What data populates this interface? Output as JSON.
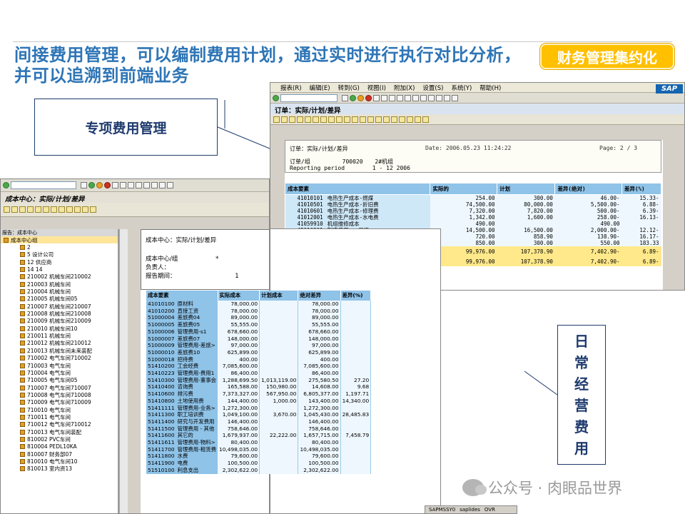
{
  "slide": {
    "title": "间接费用管理，可以编制费用计划，通过实时进行执行对比分析，并可以追溯到前端业务",
    "badge": "财务管理集约化",
    "callout_left": "专项费用管理",
    "callout_right": "日常经营费用",
    "watermark": "公众号 · 肉眼品世界",
    "colors": {
      "title": "#2e75b6",
      "badge": "#ffc000",
      "box_border": "#1f3b6e",
      "table_header": "#8fc3e8"
    }
  },
  "sap_right": {
    "menu": [
      "报表(R)",
      "编辑(E)",
      "转到(G)",
      "视图(I)",
      "附加(X)",
      "设置(S)",
      "系统(Y)",
      "帮助(H)"
    ],
    "logo": "SAP",
    "screen_title": "订单：实际/计划/差异",
    "report": {
      "name": "订单：实际/计划/差异",
      "date_label": "Date:",
      "date": "2006.05.23",
      "time": "11:24:22",
      "page_label": "Page:",
      "page": "2",
      "pages": "3",
      "order_label": "订单/组",
      "order_no": "700020",
      "order_name": "2#机组",
      "period_label": "Reporting period",
      "period_from": "1",
      "period_to": "12 2006",
      "columns": [
        "成本要素",
        "实际的",
        "计划",
        "差异(绝对)",
        "差异(%)"
      ],
      "rows": [
        [
          "41010101",
          "电热生产成本-燃煤",
          "254.00",
          "300.00",
          "46.00-",
          "15.33-"
        ],
        [
          "41010501",
          "电热生产成本-折旧费",
          "74,500.00",
          "80,000.00",
          "5,500.00-",
          "6.88-"
        ],
        [
          "41010601",
          "电热生产成本-修理费",
          "7,320.00",
          "7,820.00",
          "500.00-",
          "6.39-"
        ],
        [
          "41012001",
          "电热生产成本-水电费",
          "1,342.00",
          "1,600.00",
          "258.00-",
          "16.13-"
        ],
        [
          "41059910",
          "机组维修成本",
          "490.00",
          "",
          "490.00",
          ""
        ],
        [
          "42010201",
          "制造费用 - 工资",
          "14,500.00",
          "16,500.00",
          "2,000.00-",
          "12.12-"
        ],
        [
          "94300010",
          "检修活动成本",
          "720.00",
          "858.90",
          "138.90-",
          "16.17-"
        ],
        [
          "94300011",
          "运行工时成本",
          "850.00",
          "300.00",
          "550.00",
          "183.33"
        ]
      ],
      "total_label": "成本",
      "total_marker": "*",
      "total": [
        "99,976.00",
        "107,378.90",
        "7,402.90-",
        "6.89-"
      ],
      "balance_label": "余额",
      "balance_marker": "**",
      "balance": [
        "99,976.00",
        "107,378.90",
        "7,402.90-",
        "6.89-"
      ]
    }
  },
  "sap_left": {
    "screen_title": "成本中心：实际/计划/差异",
    "tree_header": "报告：成本中心",
    "tree_root": "成本中心组",
    "tree_items": [
      "2",
      "5 设计公司",
      "12 供应商",
      "14 14",
      "210002 机械车间210002",
      "210003 机械车间",
      "210004 机械车间",
      "210005 机械车间05",
      "210007 机械车间210007",
      "210008 机械车间210008",
      "210009 机械车间210009",
      "210010 机械车间10",
      "210011 机械车间",
      "210012 机械车间210012",
      "210013 机械车间未来装配",
      "710002 电气车间710002",
      "710003 电气车间",
      "710004 电气车间",
      "710005 电气车间05",
      "710007 电气车间710007",
      "710008 电气车间710008",
      "710009 电气车间710009",
      "710010 电气车间",
      "710011 电气车间",
      "710012 电气车间710012",
      "710013 电气车间装配",
      "810002 PVC车间",
      "810004 PEDL10KA",
      "810007 财务部07",
      "810010 电气车间10",
      "810013 室内资13"
    ],
    "report": {
      "title": "成本中心：实际/计划/差异",
      "cc_label": "成本中心/组",
      "cc_value": "*",
      "owner_label": "负责人：",
      "period_label": "报告期间：",
      "period_value": "1",
      "columns": [
        "成本要素",
        "实际成本",
        "计划成本",
        "绝对差异",
        "差异(%)"
      ],
      "rows": [
        [
          "41010100",
          "原材料",
          "78,000.00",
          "",
          "78,000.00",
          ""
        ],
        [
          "41010200",
          "直接工资",
          "78,000.00",
          "",
          "78,000.00",
          ""
        ],
        [
          "51000004",
          "差旅费04",
          "89,000.00",
          "",
          "89,000.00",
          ""
        ],
        [
          "51000005",
          "差旅费05",
          "55,555.00",
          "",
          "55,555.00",
          ""
        ],
        [
          "51000006",
          "管理费用-s1",
          "678,660.00",
          "",
          "678,660.00",
          ""
        ],
        [
          "51000007",
          "差旅费07",
          "148,000.00",
          "",
          "148,000.00",
          ""
        ],
        [
          "51000009",
          "管理费用-差旅>",
          "97,000.00",
          "",
          "97,000.00",
          ""
        ],
        [
          "51000010",
          "差旅费10",
          "625,899.00",
          "",
          "625,899.00",
          ""
        ],
        [
          "51000018",
          "招待费",
          "400.00",
          "",
          "400.00",
          ""
        ],
        [
          "51410200",
          "工会经费",
          "7,085,600.00",
          "",
          "7,085,600.00",
          ""
        ],
        [
          "51410223",
          "管理费用-费用1",
          "86,400.00",
          "",
          "86,400.00",
          ""
        ],
        [
          "51410300",
          "管理费用-董事会",
          "1,288,699.50",
          "1,013,119.00",
          "275,580.50",
          "27.20"
        ],
        [
          "51410400",
          "咨询费",
          "165,588.00",
          "150,980.00",
          "14,608.00",
          "9.68"
        ],
        [
          "51410600",
          "排污费",
          "7,373,327.00",
          "567,950.00",
          "6,805,377.00",
          "1,197.71"
        ],
        [
          "51410800",
          "土地使用费",
          "144,400.00",
          "1,000.00",
          "143,400.00",
          "14,340.00"
        ],
        [
          "51411111",
          "管理费用-业务>",
          "1,272,300.00",
          "",
          "1,272,300.00",
          ""
        ],
        [
          "51411300",
          "职工培训费",
          "1,049,100.00",
          "3,670.00",
          "1,045,430.00",
          "28,485.83"
        ],
        [
          "51411400",
          "研究与开发费用",
          "146,400.00",
          "",
          "146,400.00",
          ""
        ],
        [
          "51411500",
          "管理费用 - 其他",
          "758,646.00",
          "",
          "758,646.00",
          ""
        ],
        [
          "51411600",
          "其它的",
          "1,679,937.00",
          "22,222.00",
          "1,657,715.00",
          "7,458.79"
        ],
        [
          "51411611",
          "管理费用-物料>",
          "80,400.00",
          "",
          "80,400.00",
          ""
        ],
        [
          "51411700",
          "管理费用-租赁费",
          "10,498,035.00",
          "",
          "10,498,035.00",
          ""
        ],
        [
          "51411800",
          "水费",
          "79,600.00",
          "",
          "79,600.00",
          ""
        ],
        [
          "51411900",
          "电费",
          "100,500.00",
          "",
          "100,500.00",
          ""
        ],
        [
          "51510100",
          "利息支出",
          "2,302,622.00",
          "",
          "2,302,622.00",
          ""
        ]
      ]
    },
    "status": [
      "SAPMSSY0",
      "saplides",
      "OVR"
    ]
  }
}
